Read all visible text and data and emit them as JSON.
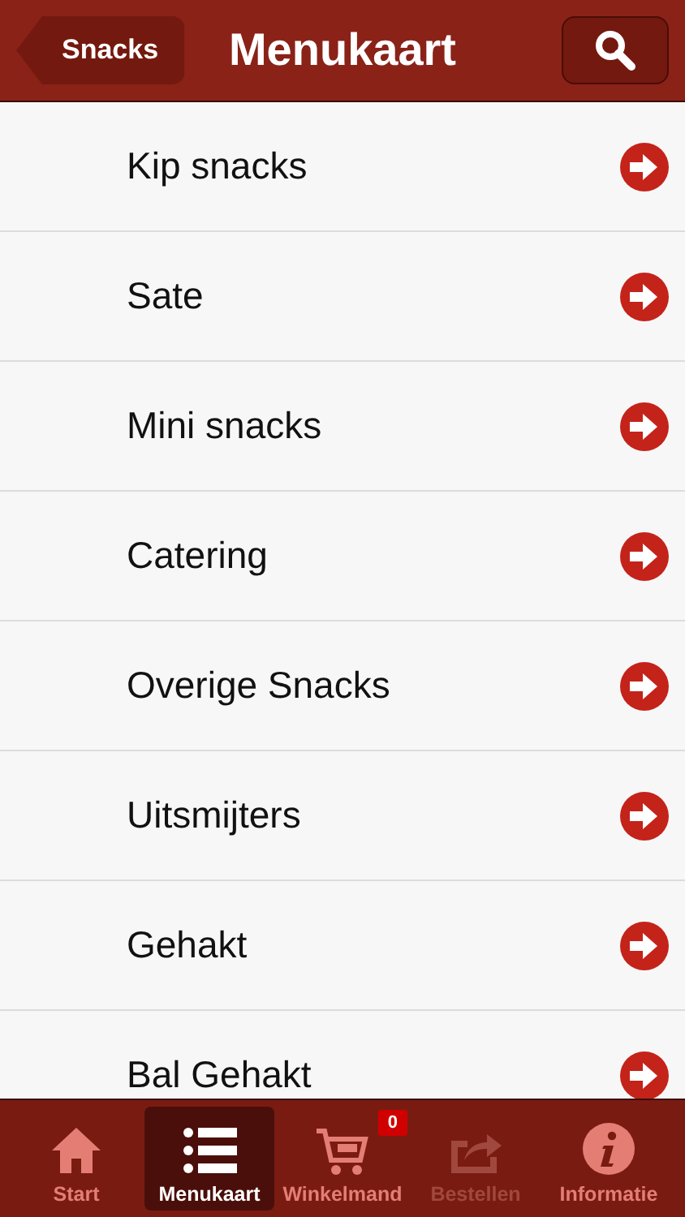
{
  "header": {
    "back": "Snacks",
    "title": "Menukaart"
  },
  "items": [
    {
      "label": "Kip snacks"
    },
    {
      "label": "Sate"
    },
    {
      "label": "Mini snacks"
    },
    {
      "label": "Catering"
    },
    {
      "label": "Overige Snacks"
    },
    {
      "label": "Uitsmijters"
    },
    {
      "label": "Gehakt"
    },
    {
      "label": "Bal Gehakt"
    }
  ],
  "tabs": [
    {
      "kind": "home",
      "label": "Start",
      "selected": false,
      "disabled": false
    },
    {
      "kind": "list",
      "label": "Menukaart",
      "selected": true,
      "disabled": false
    },
    {
      "kind": "cart",
      "label": "Winkelmand",
      "selected": false,
      "disabled": false,
      "badge": "0"
    },
    {
      "kind": "share",
      "label": "Bestellen",
      "selected": false,
      "disabled": true
    },
    {
      "kind": "info",
      "label": "Informatie",
      "selected": false,
      "disabled": false
    }
  ]
}
